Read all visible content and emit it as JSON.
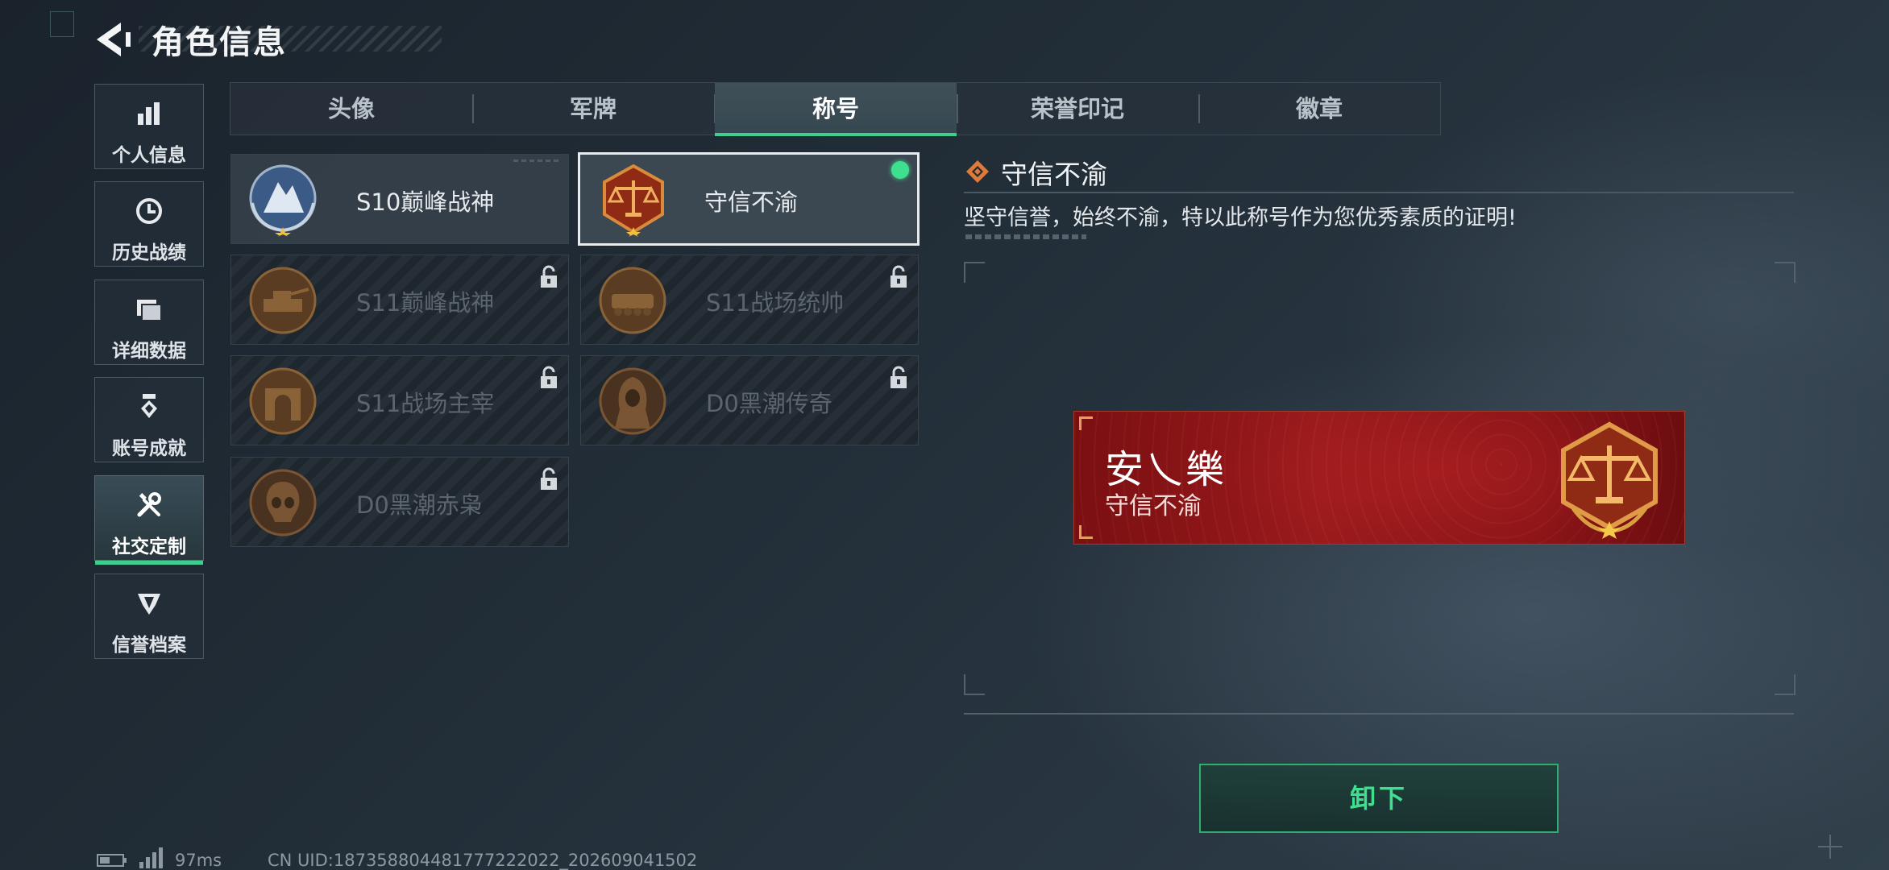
{
  "header": {
    "title": "角色信息",
    "back_icon": "chevron-left-icon"
  },
  "nav": {
    "items": [
      {
        "label": "个人信息",
        "icon": "bar-chart-icon",
        "active": false
      },
      {
        "label": "历史战绩",
        "icon": "history-clock-icon",
        "active": false
      },
      {
        "label": "详细数据",
        "icon": "folder-icon",
        "active": false
      },
      {
        "label": "账号成就",
        "icon": "trophy-medal-icon",
        "active": false
      },
      {
        "label": "社交定制",
        "icon": "wrench-screwdriver-icon",
        "active": true
      },
      {
        "label": "信誉档案",
        "icon": "shield-wing-icon",
        "active": false
      }
    ]
  },
  "tabs": [
    {
      "label": "头像",
      "active": false
    },
    {
      "label": "军牌",
      "active": false
    },
    {
      "label": "称号",
      "active": true
    },
    {
      "label": "荣誉印记",
      "active": false
    },
    {
      "label": "徽章",
      "active": false
    }
  ],
  "titles": [
    {
      "label": "S10巅峰战神",
      "locked": false,
      "selected": false,
      "emblem": "silver-peak-emblem"
    },
    {
      "label": "守信不渝",
      "locked": false,
      "selected": true,
      "equipped": true,
      "emblem": "scales-emblem"
    },
    {
      "label": "S11巅峰战神",
      "locked": true,
      "emblem": "tank-emblem"
    },
    {
      "label": "S11战场统帅",
      "locked": true,
      "emblem": "armored-vehicle-emblem"
    },
    {
      "label": "S11战场主宰",
      "locked": true,
      "emblem": "arch-emblem"
    },
    {
      "label": "D0黑潮传奇",
      "locked": true,
      "emblem": "hooded-figure-emblem"
    },
    {
      "label": "D0黑潮赤枭",
      "locked": true,
      "emblem": "skull-emblem"
    }
  ],
  "detail": {
    "title": "守信不渝",
    "description": "坚守信誉，始终不渝，特以此称号作为您优秀素质的证明!"
  },
  "nameplate": {
    "player_name": "安乀樂",
    "title": "守信不渝"
  },
  "actions": {
    "unequip_label": "卸下"
  },
  "footer": {
    "ping": "97ms",
    "uid": "CN UID:187358804481777222022_202609041502"
  },
  "colors": {
    "accent_green": "#3ecf8f",
    "equipped_dot": "#3ee08f",
    "nameplate_red": "#9a1a1c",
    "emblem_bronze": "#b5702e"
  }
}
